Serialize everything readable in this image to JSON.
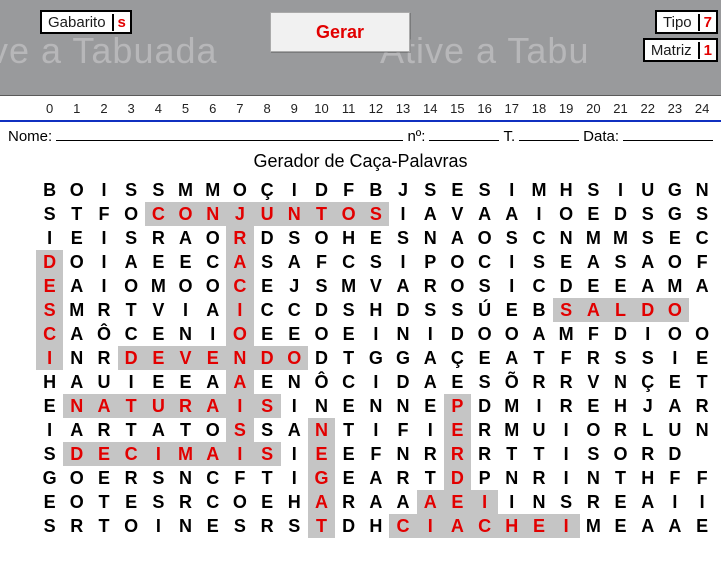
{
  "topbar": {
    "gabarito_label": "Gabarito",
    "gabarito_value": "s",
    "tipo_label": "Tipo",
    "tipo_value": "7",
    "matriz_label": "Matriz",
    "matriz_value": "1",
    "button_gerar": "Gerar",
    "watermark1": "tive a Tabuada",
    "watermark2": "Ative a Tabu"
  },
  "scale": [
    "0",
    "1",
    "2",
    "3",
    "4",
    "5",
    "6",
    "7",
    "8",
    "9",
    "10",
    "11",
    "12",
    "13",
    "14",
    "15",
    "16",
    "17",
    "18",
    "19",
    "20",
    "21",
    "22",
    "23",
    "24"
  ],
  "header": {
    "nome_label": "Nome:",
    "numero_label": "nº:",
    "turma_label": "T.",
    "data_label": "Data:"
  },
  "title": "Gerador de Caça-Palavras",
  "grid": [
    [
      [
        "B",
        0
      ],
      [
        "O",
        0
      ],
      [
        "I",
        0
      ],
      [
        "S",
        0
      ],
      [
        "S",
        0
      ],
      [
        "M",
        0
      ],
      [
        "M",
        0
      ],
      [
        "O",
        0
      ],
      [
        "Ç",
        0
      ],
      [
        "I",
        0
      ],
      [
        "D",
        0
      ],
      [
        "F",
        0
      ],
      [
        "B",
        0
      ],
      [
        "J",
        0
      ],
      [
        "S",
        0
      ],
      [
        "E",
        0
      ],
      [
        "S",
        0
      ],
      [
        "I",
        0
      ],
      [
        "M",
        0
      ],
      [
        "H",
        0
      ],
      [
        "S",
        0
      ],
      [
        "I",
        0
      ],
      [
        "U",
        0
      ],
      [
        "G",
        0
      ],
      [
        "N",
        0
      ]
    ],
    [
      [
        "S",
        0
      ],
      [
        "T",
        0
      ],
      [
        "F",
        0
      ],
      [
        "O",
        0
      ],
      [
        "C",
        1
      ],
      [
        "O",
        1
      ],
      [
        "N",
        1
      ],
      [
        "J",
        1
      ],
      [
        "U",
        1
      ],
      [
        "N",
        1
      ],
      [
        "T",
        1
      ],
      [
        "O",
        1
      ],
      [
        "S",
        1
      ],
      [
        "I",
        0
      ],
      [
        "A",
        0
      ],
      [
        "V",
        0
      ],
      [
        "A",
        0
      ],
      [
        "A",
        0
      ],
      [
        "I",
        0
      ],
      [
        "O",
        0
      ],
      [
        "E",
        0
      ],
      [
        "D",
        0
      ],
      [
        "S",
        0
      ],
      [
        "G",
        0
      ],
      [
        "S",
        0
      ]
    ],
    [
      [
        "I",
        0
      ],
      [
        "E",
        0
      ],
      [
        "I",
        0
      ],
      [
        "S",
        0
      ],
      [
        "R",
        0
      ],
      [
        "A",
        0
      ],
      [
        "O",
        0
      ],
      [
        "R",
        1
      ],
      [
        "D",
        0
      ],
      [
        "S",
        0
      ],
      [
        "O",
        0
      ],
      [
        "H",
        0
      ],
      [
        "E",
        0
      ],
      [
        "S",
        0
      ],
      [
        "N",
        0
      ],
      [
        "A",
        0
      ],
      [
        "O",
        0
      ],
      [
        "S",
        0
      ],
      [
        "C",
        0
      ],
      [
        "N",
        0
      ],
      [
        "M",
        0
      ],
      [
        "M",
        0
      ],
      [
        "S",
        0
      ],
      [
        "E",
        0
      ],
      [
        "C",
        0
      ]
    ],
    [
      [
        "D",
        1
      ],
      [
        "O",
        0
      ],
      [
        "I",
        0
      ],
      [
        "A",
        0
      ],
      [
        "E",
        0
      ],
      [
        "E",
        0
      ],
      [
        "C",
        0
      ],
      [
        "A",
        1
      ],
      [
        "S",
        0
      ],
      [
        "A",
        0
      ],
      [
        "F",
        0
      ],
      [
        "C",
        0
      ],
      [
        "S",
        0
      ],
      [
        "I",
        0
      ],
      [
        "P",
        0
      ],
      [
        "O",
        0
      ],
      [
        "C",
        0
      ],
      [
        "I",
        0
      ],
      [
        "S",
        0
      ],
      [
        "E",
        0
      ],
      [
        "A",
        0
      ],
      [
        "S",
        0
      ],
      [
        "A",
        0
      ],
      [
        "O",
        0
      ],
      [
        "F",
        0
      ]
    ],
    [
      [
        "E",
        1
      ],
      [
        "A",
        0
      ],
      [
        "I",
        0
      ],
      [
        "O",
        0
      ],
      [
        "M",
        0
      ],
      [
        "O",
        0
      ],
      [
        "O",
        0
      ],
      [
        "C",
        1
      ],
      [
        "E",
        0
      ],
      [
        "J",
        0
      ],
      [
        "S",
        0
      ],
      [
        "M",
        0
      ],
      [
        "V",
        0
      ],
      [
        "A",
        0
      ],
      [
        "R",
        0
      ],
      [
        "O",
        0
      ],
      [
        "S",
        0
      ],
      [
        "I",
        0
      ],
      [
        "C",
        0
      ],
      [
        "D",
        0
      ],
      [
        "E",
        0
      ],
      [
        "E",
        0
      ],
      [
        "A",
        0
      ],
      [
        "M",
        0
      ],
      [
        "A",
        0
      ]
    ],
    [
      [
        "S",
        1
      ],
      [
        "M",
        0
      ],
      [
        "R",
        0
      ],
      [
        "T",
        0
      ],
      [
        "V",
        0
      ],
      [
        "I",
        0
      ],
      [
        "A",
        0
      ],
      [
        "I",
        1
      ],
      [
        "C",
        0
      ],
      [
        "C",
        0
      ],
      [
        "D",
        0
      ],
      [
        "S",
        0
      ],
      [
        "H",
        0
      ],
      [
        "D",
        0
      ],
      [
        "S",
        0
      ],
      [
        "S",
        0
      ],
      [
        "Ú",
        0
      ],
      [
        "E",
        0
      ],
      [
        "B",
        0
      ],
      [
        "S",
        1
      ],
      [
        "A",
        1
      ],
      [
        "L",
        1
      ],
      [
        "D",
        1
      ],
      [
        "O",
        1
      ],
      [
        "",
        0
      ]
    ],
    [
      [
        "C",
        1
      ],
      [
        "A",
        0
      ],
      [
        "Ô",
        0
      ],
      [
        "C",
        0
      ],
      [
        "E",
        0
      ],
      [
        "N",
        0
      ],
      [
        "I",
        0
      ],
      [
        "O",
        1
      ],
      [
        "E",
        0
      ],
      [
        "E",
        0
      ],
      [
        "O",
        0
      ],
      [
        "E",
        0
      ],
      [
        "I",
        0
      ],
      [
        "N",
        0
      ],
      [
        "I",
        0
      ],
      [
        "D",
        0
      ],
      [
        "O",
        0
      ],
      [
        "O",
        0
      ],
      [
        "A",
        0
      ],
      [
        "M",
        0
      ],
      [
        "F",
        0
      ],
      [
        "D",
        0
      ],
      [
        "I",
        0
      ],
      [
        "O",
        0
      ],
      [
        "O",
        0
      ]
    ],
    [
      [
        "I",
        1
      ],
      [
        "N",
        0
      ],
      [
        "R",
        0
      ],
      [
        "D",
        1
      ],
      [
        "E",
        1
      ],
      [
        "V",
        1
      ],
      [
        "E",
        1
      ],
      [
        "N",
        1
      ],
      [
        "D",
        1
      ],
      [
        "O",
        1
      ],
      [
        "D",
        0
      ],
      [
        "T",
        0
      ],
      [
        "G",
        0
      ],
      [
        "G",
        0
      ],
      [
        "A",
        0
      ],
      [
        "Ç",
        0
      ],
      [
        "E",
        0
      ],
      [
        "A",
        0
      ],
      [
        "T",
        0
      ],
      [
        "F",
        0
      ],
      [
        "R",
        0
      ],
      [
        "S",
        0
      ],
      [
        "S",
        0
      ],
      [
        "I",
        0
      ],
      [
        "E",
        0
      ]
    ],
    [
      [
        "H",
        0
      ],
      [
        "A",
        0
      ],
      [
        "U",
        0
      ],
      [
        "I",
        0
      ],
      [
        "E",
        0
      ],
      [
        "E",
        0
      ],
      [
        "A",
        0
      ],
      [
        "A",
        1
      ],
      [
        "E",
        0
      ],
      [
        "N",
        0
      ],
      [
        "Ô",
        0
      ],
      [
        "C",
        0
      ],
      [
        "I",
        0
      ],
      [
        "D",
        0
      ],
      [
        "A",
        0
      ],
      [
        "E",
        0
      ],
      [
        "S",
        0
      ],
      [
        "Õ",
        0
      ],
      [
        "R",
        0
      ],
      [
        "R",
        0
      ],
      [
        "V",
        0
      ],
      [
        "N",
        0
      ],
      [
        "Ç",
        0
      ],
      [
        "E",
        0
      ],
      [
        "T",
        0
      ]
    ],
    [
      [
        "E",
        0
      ],
      [
        "N",
        1
      ],
      [
        "A",
        1
      ],
      [
        "T",
        1
      ],
      [
        "U",
        1
      ],
      [
        "R",
        1
      ],
      [
        "A",
        1
      ],
      [
        "I",
        1
      ],
      [
        "S",
        1
      ],
      [
        "I",
        0
      ],
      [
        "N",
        0
      ],
      [
        "E",
        0
      ],
      [
        "N",
        0
      ],
      [
        "N",
        0
      ],
      [
        "E",
        0
      ],
      [
        "P",
        1
      ],
      [
        "D",
        0
      ],
      [
        "M",
        0
      ],
      [
        "I",
        0
      ],
      [
        "R",
        0
      ],
      [
        "E",
        0
      ],
      [
        "H",
        0
      ],
      [
        "J",
        0
      ],
      [
        "A",
        0
      ],
      [
        "R",
        0
      ]
    ],
    [
      [
        "I",
        0
      ],
      [
        "A",
        0
      ],
      [
        "R",
        0
      ],
      [
        "T",
        0
      ],
      [
        "A",
        0
      ],
      [
        "T",
        0
      ],
      [
        "O",
        0
      ],
      [
        "S",
        1
      ],
      [
        "S",
        0
      ],
      [
        "A",
        0
      ],
      [
        "N",
        1
      ],
      [
        "T",
        0
      ],
      [
        "I",
        0
      ],
      [
        "F",
        0
      ],
      [
        "I",
        0
      ],
      [
        "E",
        1
      ],
      [
        "R",
        0
      ],
      [
        "M",
        0
      ],
      [
        "U",
        0
      ],
      [
        "I",
        0
      ],
      [
        "O",
        0
      ],
      [
        "R",
        0
      ],
      [
        "L",
        0
      ],
      [
        "U",
        0
      ],
      [
        "N",
        0
      ]
    ],
    [
      [
        "S",
        0
      ],
      [
        "D",
        1
      ],
      [
        "E",
        1
      ],
      [
        "C",
        1
      ],
      [
        "I",
        1
      ],
      [
        "M",
        1
      ],
      [
        "A",
        1
      ],
      [
        "I",
        1
      ],
      [
        "S",
        1
      ],
      [
        "I",
        0
      ],
      [
        "E",
        1
      ],
      [
        "E",
        0
      ],
      [
        "F",
        0
      ],
      [
        "N",
        0
      ],
      [
        "R",
        0
      ],
      [
        "R",
        1
      ],
      [
        "R",
        0
      ],
      [
        "T",
        0
      ],
      [
        "T",
        0
      ],
      [
        "I",
        0
      ],
      [
        "S",
        0
      ],
      [
        "O",
        0
      ],
      [
        "R",
        0
      ],
      [
        "D",
        0
      ],
      [
        "",
        0
      ]
    ],
    [
      [
        "G",
        0
      ],
      [
        "O",
        0
      ],
      [
        "E",
        0
      ],
      [
        "R",
        0
      ],
      [
        "S",
        0
      ],
      [
        "N",
        0
      ],
      [
        "C",
        0
      ],
      [
        "F",
        0
      ],
      [
        "T",
        0
      ],
      [
        "I",
        0
      ],
      [
        "G",
        1
      ],
      [
        "E",
        0
      ],
      [
        "A",
        0
      ],
      [
        "R",
        0
      ],
      [
        "T",
        0
      ],
      [
        "D",
        1
      ],
      [
        "P",
        0
      ],
      [
        "N",
        0
      ],
      [
        "R",
        0
      ],
      [
        "I",
        0
      ],
      [
        "N",
        0
      ],
      [
        "T",
        0
      ],
      [
        "H",
        0
      ],
      [
        "F",
        0
      ],
      [
        "F",
        0
      ]
    ],
    [
      [
        "E",
        0
      ],
      [
        "O",
        0
      ],
      [
        "T",
        0
      ],
      [
        "E",
        0
      ],
      [
        "S",
        0
      ],
      [
        "R",
        0
      ],
      [
        "C",
        0
      ],
      [
        "O",
        0
      ],
      [
        "E",
        0
      ],
      [
        "H",
        0
      ],
      [
        "A",
        1
      ],
      [
        "R",
        0
      ],
      [
        "A",
        0
      ],
      [
        "A",
        0
      ],
      [
        "A",
        1
      ],
      [
        "E",
        1
      ],
      [
        "I",
        1
      ],
      [
        "I",
        0
      ],
      [
        "N",
        0
      ],
      [
        "S",
        0
      ],
      [
        "R",
        0
      ],
      [
        "E",
        0
      ],
      [
        "A",
        0
      ],
      [
        "I",
        0
      ],
      [
        "I",
        0
      ]
    ],
    [
      [
        "S",
        0
      ],
      [
        "R",
        0
      ],
      [
        "T",
        0
      ],
      [
        "O",
        0
      ],
      [
        "I",
        0
      ],
      [
        "N",
        0
      ],
      [
        "E",
        0
      ],
      [
        "S",
        0
      ],
      [
        "R",
        0
      ],
      [
        "S",
        0
      ],
      [
        "T",
        1
      ],
      [
        "D",
        0
      ],
      [
        "H",
        0
      ],
      [
        "C",
        1
      ],
      [
        "I",
        1
      ],
      [
        "A",
        1
      ],
      [
        "C",
        1
      ],
      [
        "H",
        1
      ],
      [
        "E",
        1
      ],
      [
        "I",
        1
      ],
      [
        "M",
        0
      ],
      [
        "E",
        0
      ],
      [
        "A",
        0
      ],
      [
        "A",
        0
      ],
      [
        "E",
        0
      ]
    ]
  ]
}
